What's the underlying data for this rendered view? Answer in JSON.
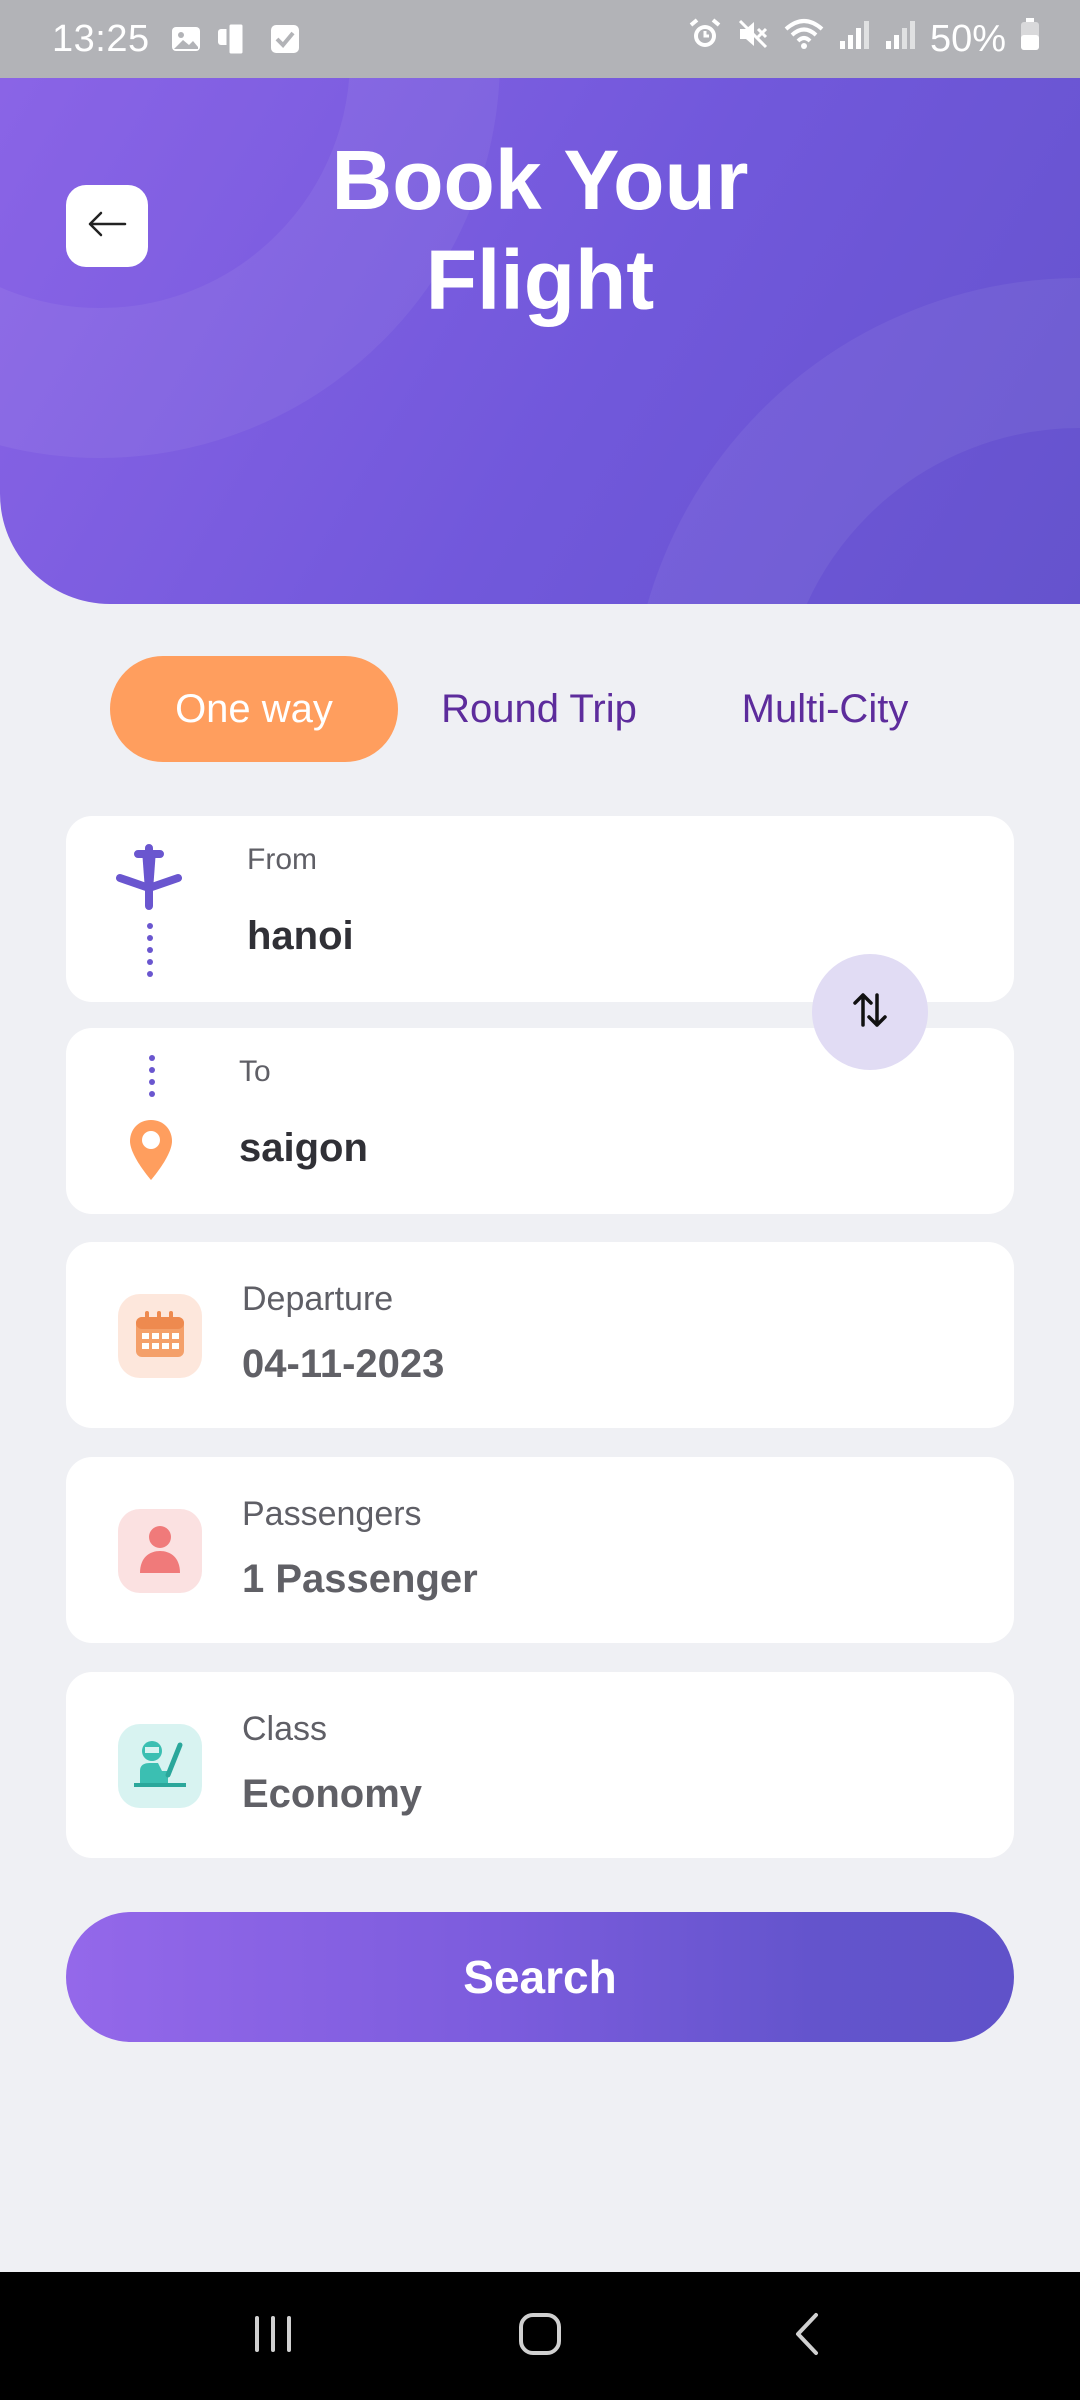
{
  "status_bar": {
    "time": "13:25",
    "battery": "50%",
    "icons_left": [
      "image-icon",
      "device-icon",
      "checkbox-icon"
    ],
    "icons_right": [
      "alarm-icon",
      "mute-icon",
      "wifi-icon",
      "signal-icon",
      "signal-icon",
      "battery-icon"
    ]
  },
  "header": {
    "title_line1": "Book Your",
    "title_line2": "Flight",
    "back_icon": "arrow-left-icon"
  },
  "trip_tabs": [
    {
      "label": "One way",
      "active": true
    },
    {
      "label": "Round Trip",
      "active": false
    },
    {
      "label": "Multi-City",
      "active": false
    }
  ],
  "from": {
    "label": "From",
    "value": "hanoi",
    "icon": "airplane-icon"
  },
  "to": {
    "label": "To",
    "value": "saigon",
    "icon": "location-pin-icon"
  },
  "swap_icon": "swap-vertical-icon",
  "departure": {
    "label": "Departure",
    "value": "04-11-2023",
    "icon": "calendar-icon"
  },
  "passengers": {
    "label": "Passengers",
    "value": "1 Passenger",
    "icon": "person-icon"
  },
  "class": {
    "label": "Class",
    "value": "Economy",
    "icon": "seat-icon"
  },
  "search_button": "Search",
  "colors": {
    "primary": "#7158db",
    "accent_orange": "#ff9e5e",
    "tab_text": "#5d2c9c",
    "background": "#eff0f4"
  },
  "nav": [
    "recents-icon",
    "home-icon",
    "back-icon"
  ]
}
